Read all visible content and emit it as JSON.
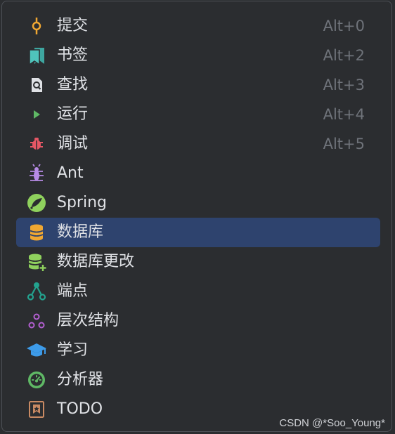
{
  "menu": {
    "items": [
      {
        "label": "提交",
        "shortcut": "Alt+0",
        "icon": "commit-icon"
      },
      {
        "label": "书签",
        "shortcut": "Alt+2",
        "icon": "bookmarks-icon"
      },
      {
        "label": "查找",
        "shortcut": "Alt+3",
        "icon": "find-icon"
      },
      {
        "label": "运行",
        "shortcut": "Alt+4",
        "icon": "run-icon"
      },
      {
        "label": "调试",
        "shortcut": "Alt+5",
        "icon": "debug-icon"
      },
      {
        "label": "Ant",
        "shortcut": "",
        "icon": "ant-icon"
      },
      {
        "label": "Spring",
        "shortcut": "",
        "icon": "spring-icon"
      },
      {
        "label": "数据库",
        "shortcut": "",
        "icon": "database-icon",
        "selected": true
      },
      {
        "label": "数据库更改",
        "shortcut": "",
        "icon": "database-changes-icon"
      },
      {
        "label": "端点",
        "shortcut": "",
        "icon": "endpoints-icon"
      },
      {
        "label": "层次结构",
        "shortcut": "",
        "icon": "hierarchy-icon"
      },
      {
        "label": "学习",
        "shortcut": "",
        "icon": "learn-icon"
      },
      {
        "label": "分析器",
        "shortcut": "",
        "icon": "profiler-icon"
      },
      {
        "label": "TODO",
        "shortcut": "",
        "icon": "todo-icon"
      }
    ]
  },
  "watermark": "CSDN @*Soo_Young*",
  "colors": {
    "background": "#2b2d30",
    "selected": "#2e436e",
    "text": "#dfe1e5",
    "shortcut": "#6f737a"
  }
}
